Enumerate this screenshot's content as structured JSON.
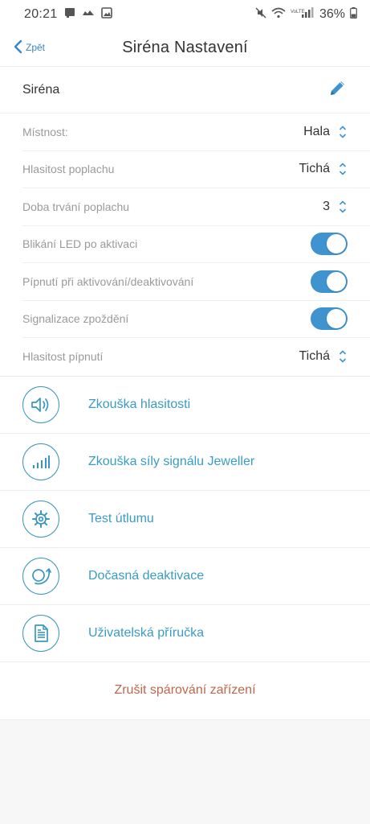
{
  "status_bar": {
    "time": "20:21",
    "battery": "36%",
    "network": "VoLTE",
    "left_icons": [
      "notification-icon",
      "cloud-icon",
      "gallery-icon"
    ],
    "right_icons": [
      "mute-icon",
      "wifi-icon",
      "signal-icon",
      "battery-icon"
    ]
  },
  "navbar": {
    "back_label": "Zpět",
    "title": "Siréna Nastavení"
  },
  "device": {
    "name": "Siréna",
    "edit_icon": "pencil-icon"
  },
  "settings": [
    {
      "label": "Místnost:",
      "type": "select",
      "value": "Hala"
    },
    {
      "label": "Hlasitost poplachu",
      "type": "select",
      "value": "Tichá"
    },
    {
      "label": "Doba trvání poplachu",
      "type": "select",
      "value": "3"
    },
    {
      "label": "Blikání LED po aktivaci",
      "type": "toggle",
      "on": true
    },
    {
      "label": "Pípnutí při aktivování/deaktivování",
      "type": "toggle",
      "on": true
    },
    {
      "label": "Signalizace zpoždění",
      "type": "toggle",
      "on": true
    },
    {
      "label": "Hlasitost pípnutí",
      "type": "select",
      "value": "Tichá"
    }
  ],
  "actions": [
    {
      "label": "Zkouška hlasitosti",
      "icon": "speaker-icon"
    },
    {
      "label": "Zkouška síly signálu Jeweller",
      "icon": "signal-bars-icon"
    },
    {
      "label": "Test útlumu",
      "icon": "gear-icon"
    },
    {
      "label": "Dočasná deaktivace",
      "icon": "deactivate-icon"
    },
    {
      "label": "Uživatelská příručka",
      "icon": "document-icon"
    }
  ],
  "unpair_label": "Zrušit spárování zařízení",
  "colors": {
    "accent": "#3f94cf",
    "action_text": "#3a9cc3",
    "danger_text": "#c0674d",
    "label_gray": "#9a9a9a"
  }
}
